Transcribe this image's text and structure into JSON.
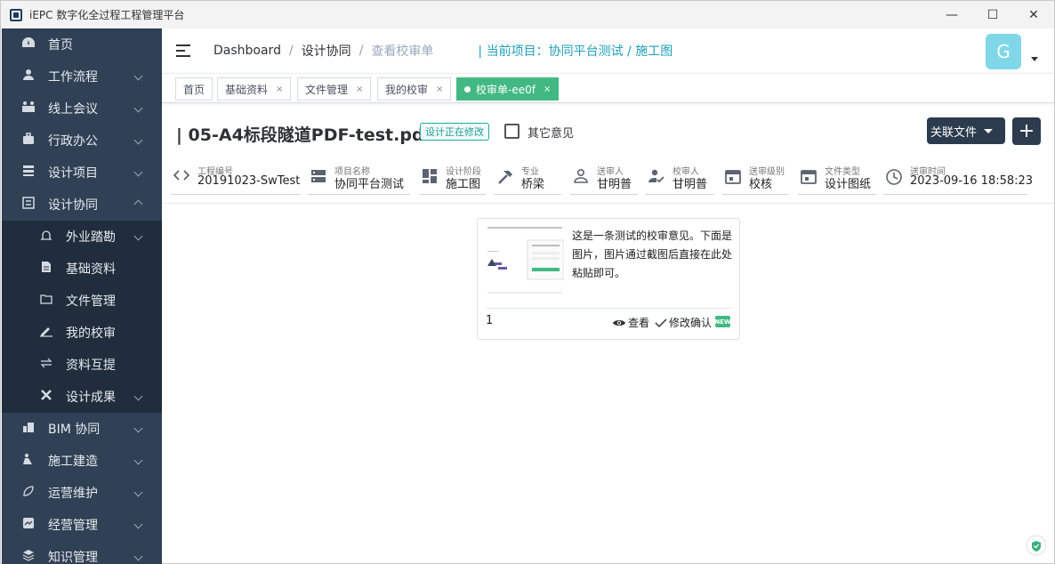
{
  "window": {
    "title": "iEPC 数字化全过程工程管理平台",
    "minimize": "—",
    "maximize": "☐",
    "close": "✕"
  },
  "sidebar": {
    "items": [
      {
        "label": "首页",
        "icon": "dashboard-icon"
      },
      {
        "label": "工作流程",
        "icon": "user-icon"
      },
      {
        "label": "线上会议",
        "icon": "meeting-icon"
      },
      {
        "label": "行政办公",
        "icon": "briefcase-icon"
      },
      {
        "label": "设计项目",
        "icon": "list-icon"
      },
      {
        "label": "设计协同",
        "icon": "collab-icon"
      }
    ],
    "subitems": [
      {
        "label": "外业踏勘",
        "icon": "bell-icon"
      },
      {
        "label": "基础资料",
        "icon": "document-icon"
      },
      {
        "label": "文件管理",
        "icon": "folder-icon"
      },
      {
        "label": "我的校审",
        "icon": "sign-icon"
      },
      {
        "label": "资料互提",
        "icon": "exchange-icon"
      },
      {
        "label": "设计成果",
        "icon": "tools-icon"
      }
    ],
    "lower": [
      {
        "label": "BIM 协同",
        "icon": "building-icon"
      },
      {
        "label": "施工建造",
        "icon": "construction-icon"
      },
      {
        "label": "运营维护",
        "icon": "leaf-icon"
      },
      {
        "label": "经营管理",
        "icon": "chart-icon"
      },
      {
        "label": "知识管理",
        "icon": "stack-icon"
      }
    ]
  },
  "header": {
    "crumbs": [
      "Dashboard",
      "设计协同",
      "查看校审单"
    ],
    "project_prefix": "| 当前项目：",
    "project": "协同平台测试 / 施工图",
    "avatar": "G"
  },
  "tags": [
    {
      "label": "首页",
      "closable": false
    },
    {
      "label": "基础资料",
      "closable": true
    },
    {
      "label": "文件管理",
      "closable": true
    },
    {
      "label": "我的校审",
      "closable": true
    },
    {
      "label": "校审单-ee0f",
      "closable": true,
      "active": true
    }
  ],
  "tag_close": "×",
  "doc": {
    "title": "| 05-A4标段隧道PDF-test.pdf",
    "status": "设计正在修改",
    "other_opinion": "其它意见",
    "assoc_button": "关联文件",
    "add_button": "+"
  },
  "meta": [
    {
      "label": "工程编号",
      "value": "20191023-SwTest",
      "icon": "code-icon"
    },
    {
      "label": "项目名称",
      "value": "协同平台测试",
      "icon": "server-icon"
    },
    {
      "label": "设计阶段",
      "value": "施工图",
      "icon": "dashboard-grid-icon"
    },
    {
      "label": "专业",
      "value": "桥梁",
      "icon": "hammer-icon"
    },
    {
      "label": "送审人",
      "value": "甘明普",
      "icon": "person-icon"
    },
    {
      "label": "校审人",
      "value": "甘明普",
      "icon": "person-check-icon"
    },
    {
      "label": "送审级别",
      "value": "校核",
      "icon": "calendar-icon"
    },
    {
      "label": "文件类型",
      "value": "设计图纸",
      "icon": "calendar-icon"
    },
    {
      "label": "送审时间",
      "value": "2023-09-16 18:58:23",
      "icon": "clock-icon"
    }
  ],
  "opinion": {
    "text": "这是一条测试的校审意见。下面是图片，图片通过截图后直接在此处粘贴即可。",
    "number": "1",
    "view": "查看",
    "confirm": "修改确认",
    "new_badge": "NEW"
  },
  "colors": {
    "sidebar": "#304156",
    "accent": "#42b983",
    "teal": "#1ea1b8",
    "button": "#2c3b4e"
  }
}
